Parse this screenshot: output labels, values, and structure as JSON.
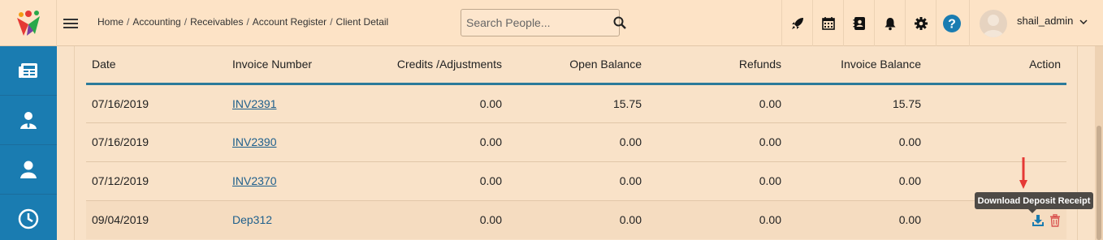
{
  "header": {
    "breadcrumb": [
      "Home",
      "Accounting",
      "Receivables",
      "Account Register",
      "Client Detail"
    ],
    "search_placeholder": "Search People...",
    "icons": [
      "rocket-icon",
      "calendar-icon",
      "address-book-icon",
      "bell-icon",
      "gear-icon",
      "help-icon"
    ],
    "username": "shail_admin"
  },
  "sidebar": {
    "items": [
      "newspaper-icon",
      "user-tie-icon",
      "user-icon",
      "clock-icon"
    ]
  },
  "table": {
    "columns": [
      "Date",
      "Invoice Number",
      "Credits /Adjustments",
      "Open Balance",
      "Refunds",
      "Invoice Balance",
      "Action"
    ],
    "rows": [
      {
        "date": "07/16/2019",
        "invoice": "INV2391",
        "credits": "0.00",
        "open": "15.75",
        "refunds": "0.00",
        "balance": "15.75"
      },
      {
        "date": "07/16/2019",
        "invoice": "INV2390",
        "credits": "0.00",
        "open": "0.00",
        "refunds": "0.00",
        "balance": "0.00"
      },
      {
        "date": "07/12/2019",
        "invoice": "INV2370",
        "credits": "0.00",
        "open": "0.00",
        "refunds": "0.00",
        "balance": "0.00"
      },
      {
        "date": "09/04/2019",
        "invoice": "Dep312",
        "credits": "0.00",
        "open": "0.00",
        "refunds": "0.00",
        "balance": "0.00"
      }
    ]
  },
  "tooltip": "Download Deposit Receipt",
  "colors": {
    "accent": "#1a7cb1",
    "header_bg": "#fde3c6",
    "link": "#1e5f8c",
    "delete": "#d9534f",
    "annotation": "#e53935"
  }
}
